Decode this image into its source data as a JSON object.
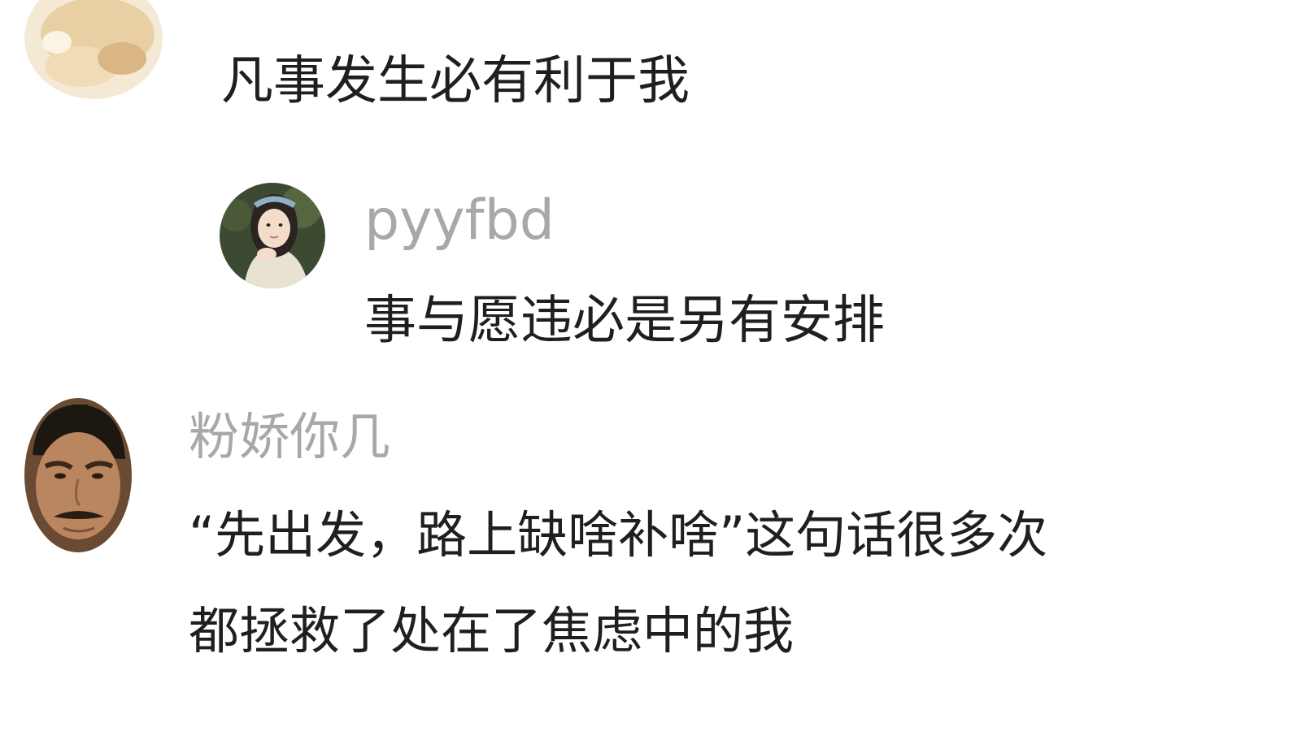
{
  "comments": [
    {
      "avatar_icon": "user-avatar-photo-icon",
      "text": "凡事发生必有利于我"
    },
    {
      "avatar_icon": "user-avatar-photo-icon",
      "username": "pyyfbd",
      "text": "事与愿违必是另有安排"
    },
    {
      "avatar_icon": "user-avatar-photo-icon",
      "username": "粉娇你几",
      "text_lines": [
        "“先出发，路上缺啥补啥”这句话很多次",
        "都拯救了处在了焦虑中的我"
      ]
    }
  ],
  "colors": {
    "background": "#ffffff",
    "text": "#1f1f1f",
    "username": "#a8a8a8"
  }
}
